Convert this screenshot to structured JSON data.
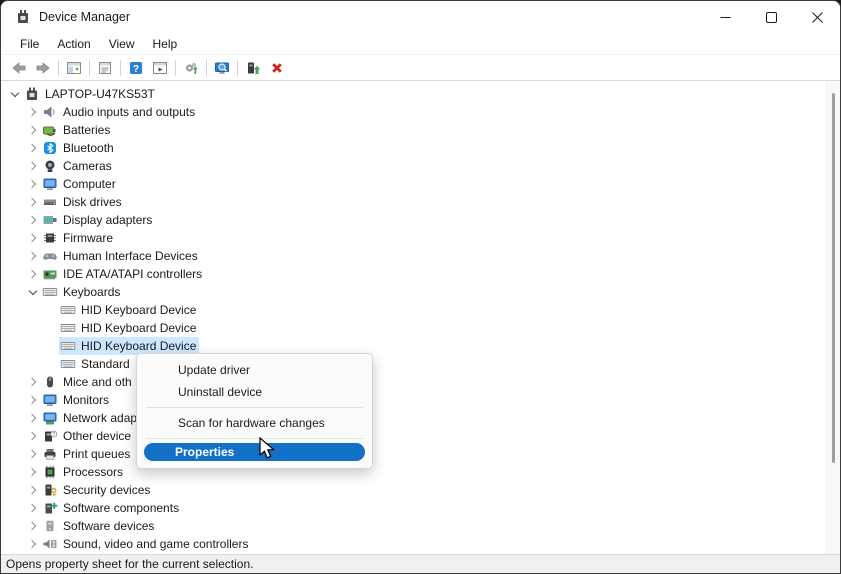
{
  "window": {
    "title": "Device Manager"
  },
  "window_controls": [
    {
      "name": "minimize",
      "icon": "minimize-icon"
    },
    {
      "name": "maximize",
      "icon": "maximize-icon"
    },
    {
      "name": "close",
      "icon": "close-icon"
    }
  ],
  "menu_bar": {
    "items": [
      "File",
      "Action",
      "View",
      "Help"
    ]
  },
  "toolbar": {
    "items": [
      {
        "type": "button",
        "icon": "back-icon"
      },
      {
        "type": "button",
        "icon": "forward-icon"
      },
      {
        "type": "separator"
      },
      {
        "type": "button",
        "icon": "console-tree-icon"
      },
      {
        "type": "separator"
      },
      {
        "type": "button",
        "icon": "properties-icon"
      },
      {
        "type": "separator"
      },
      {
        "type": "button",
        "icon": "help-icon"
      },
      {
        "type": "button",
        "icon": "action-pane-icon"
      },
      {
        "type": "separator"
      },
      {
        "type": "button",
        "icon": "scan-hardware-icon"
      },
      {
        "type": "separator"
      },
      {
        "type": "button",
        "icon": "remote-computer-icon"
      },
      {
        "type": "separator"
      },
      {
        "type": "button",
        "icon": "update-driver-icon"
      },
      {
        "type": "button",
        "icon": "uninstall-device-icon"
      }
    ]
  },
  "tree": {
    "items": [
      {
        "label": "LAPTOP-U47KS53T",
        "level": 0,
        "state": "expanded",
        "icon": "computer-icon",
        "selected": false
      },
      {
        "label": "Audio inputs and outputs",
        "level": 1,
        "state": "collapsed",
        "icon": "speaker-icon",
        "selected": false
      },
      {
        "label": "Batteries",
        "level": 1,
        "state": "collapsed",
        "icon": "battery-icon",
        "selected": false
      },
      {
        "label": "Bluetooth",
        "level": 1,
        "state": "collapsed",
        "icon": "bluetooth-icon",
        "selected": false
      },
      {
        "label": "Cameras",
        "level": 1,
        "state": "collapsed",
        "icon": "camera-icon",
        "selected": false
      },
      {
        "label": "Computer",
        "level": 1,
        "state": "collapsed",
        "icon": "monitor-icon",
        "selected": false
      },
      {
        "label": "Disk drives",
        "level": 1,
        "state": "collapsed",
        "icon": "disk-drive-icon",
        "selected": false
      },
      {
        "label": "Display adapters",
        "level": 1,
        "state": "collapsed",
        "icon": "display-adapter-icon",
        "selected": false
      },
      {
        "label": "Firmware",
        "level": 1,
        "state": "collapsed",
        "icon": "firmware-icon",
        "selected": false
      },
      {
        "label": "Human Interface Devices",
        "level": 1,
        "state": "collapsed",
        "icon": "hid-icon",
        "selected": false
      },
      {
        "label": "IDE ATA/ATAPI controllers",
        "level": 1,
        "state": "collapsed",
        "icon": "ide-controller-icon",
        "selected": false
      },
      {
        "label": "Keyboards",
        "level": 1,
        "state": "expanded",
        "icon": "keyboard-icon",
        "selected": false
      },
      {
        "label": "HID Keyboard Device",
        "level": 2,
        "state": "leaf",
        "icon": "keyboard-icon",
        "selected": false
      },
      {
        "label": "HID Keyboard Device",
        "level": 2,
        "state": "leaf",
        "icon": "keyboard-icon",
        "selected": false
      },
      {
        "label": "HID Keyboard Device",
        "level": 2,
        "state": "leaf",
        "icon": "keyboard-icon",
        "selected": true
      },
      {
        "label": "Standard",
        "level": 2,
        "state": "leaf",
        "icon": "keyboard-icon",
        "selected": false
      },
      {
        "label": "Mice and oth",
        "level": 1,
        "state": "collapsed",
        "icon": "mouse-icon",
        "selected": false
      },
      {
        "label": "Monitors",
        "level": 1,
        "state": "collapsed",
        "icon": "monitor-icon",
        "selected": false
      },
      {
        "label": "Network adap",
        "level": 1,
        "state": "collapsed",
        "icon": "network-adapter-icon",
        "selected": false
      },
      {
        "label": "Other device",
        "level": 1,
        "state": "collapsed",
        "icon": "unknown-device-icon",
        "selected": false
      },
      {
        "label": "Print queues",
        "level": 1,
        "state": "collapsed",
        "icon": "printer-icon",
        "selected": false
      },
      {
        "label": "Processors",
        "level": 1,
        "state": "collapsed",
        "icon": "processor-icon",
        "selected": false
      },
      {
        "label": "Security devices",
        "level": 1,
        "state": "collapsed",
        "icon": "security-device-icon",
        "selected": false
      },
      {
        "label": "Software components",
        "level": 1,
        "state": "collapsed",
        "icon": "software-component-icon",
        "selected": false
      },
      {
        "label": "Software devices",
        "level": 1,
        "state": "collapsed",
        "icon": "software-device-icon",
        "selected": false
      },
      {
        "label": "Sound, video and game controllers",
        "level": 1,
        "state": "collapsed",
        "icon": "sound-controller-icon",
        "selected": false
      }
    ]
  },
  "context_menu": {
    "items": [
      {
        "type": "item",
        "label": "Update driver",
        "highlighted": false
      },
      {
        "type": "item",
        "label": "Uninstall device",
        "highlighted": false
      },
      {
        "type": "separator"
      },
      {
        "type": "item",
        "label": "Scan for hardware changes",
        "highlighted": false
      },
      {
        "type": "separator"
      },
      {
        "type": "item",
        "label": "Properties",
        "highlighted": true
      }
    ]
  },
  "status_bar": {
    "text": "Opens property sheet for the current selection."
  },
  "colors": {
    "selection_bg": "#cce8ff",
    "menu_highlight": "#1271c7",
    "uninstall_red": "#c42b1c",
    "accent_blue": "#2d7dd2"
  }
}
